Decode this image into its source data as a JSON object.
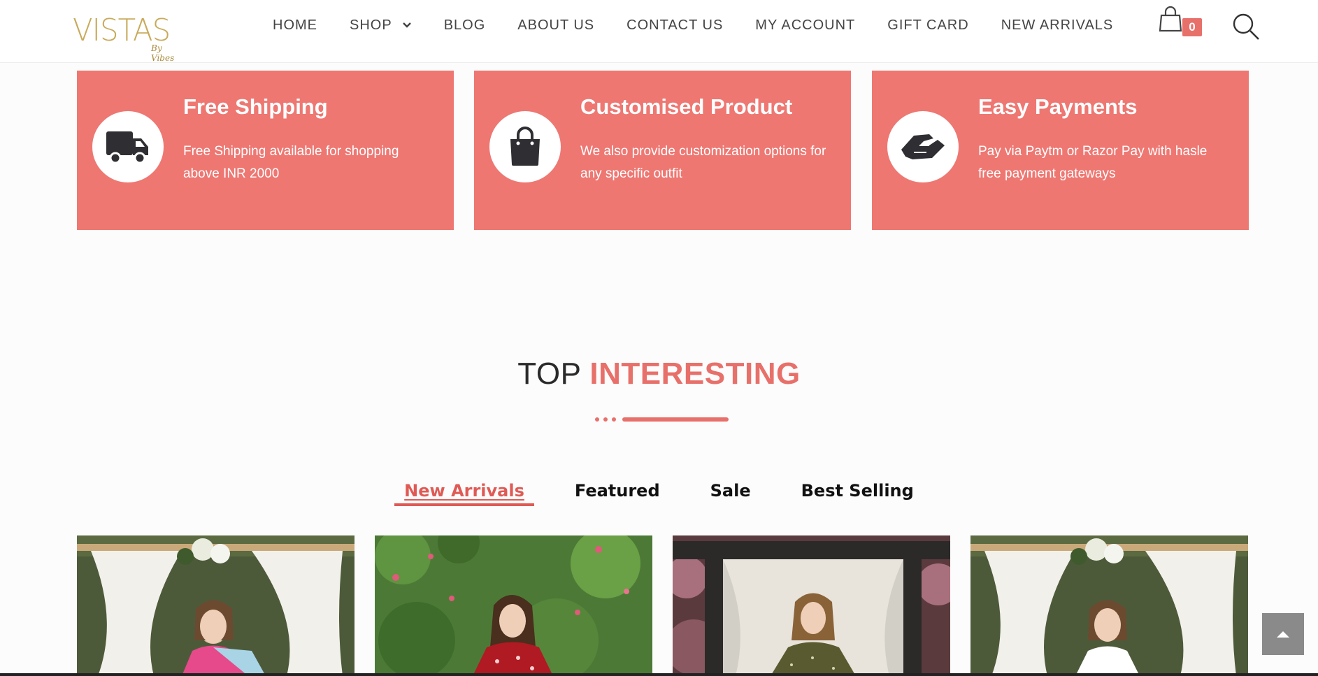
{
  "header": {
    "logo": {
      "brand": "VISTAS",
      "sub": "By Vibes"
    },
    "nav": [
      {
        "label": "HOME"
      },
      {
        "label": "SHOP",
        "has_dropdown": true
      },
      {
        "label": "BLOG"
      },
      {
        "label": "ABOUT US"
      },
      {
        "label": "CONTACT US"
      },
      {
        "label": "MY ACCOUNT"
      },
      {
        "label": "GIFT CARD"
      },
      {
        "label": "NEW ARRIVALS"
      }
    ],
    "cart_count": "0"
  },
  "features": [
    {
      "title": "Free Shipping",
      "text": "Free Shipping available for shopping above INR 2000",
      "icon": "truck-icon"
    },
    {
      "title": "Customised Product",
      "text": "We also provide customization options for any specific outfit",
      "icon": "shopping-bag-icon"
    },
    {
      "title": "Easy Payments",
      "text": "Pay via Paytm or Razor Pay with hasle free payment gateways",
      "icon": "handshake-icon"
    }
  ],
  "section": {
    "title_a": "TOP",
    "title_b": "INTERESTING"
  },
  "tabs": [
    {
      "label": "New Arrivals",
      "active": true
    },
    {
      "label": "Featured"
    },
    {
      "label": "Sale"
    },
    {
      "label": "Best Selling"
    }
  ],
  "colors": {
    "accent": "#ee7772",
    "gold": "#c8aa5a"
  }
}
